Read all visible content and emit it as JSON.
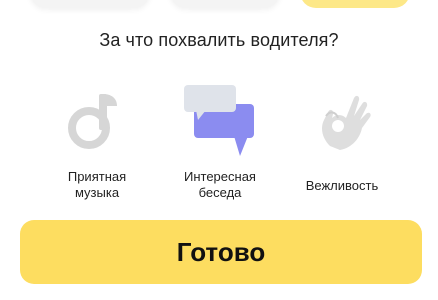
{
  "question": "За что похвалить водителя?",
  "options": [
    {
      "label_line1": "Приятная",
      "label_line2": "музыка",
      "icon": "music-note-icon",
      "selected": false
    },
    {
      "label_line1": "Интересная",
      "label_line2": "беседа",
      "icon": "chat-bubbles-icon",
      "selected": true
    },
    {
      "label_line1": "Вежливость",
      "label_line2": "",
      "icon": "ok-hand-icon",
      "selected": false
    }
  ],
  "done_label": "Готово",
  "colors": {
    "accent": "#fddd60",
    "selected_icon": "#8b8cf0",
    "inactive_icon": "#d4d4d4"
  }
}
